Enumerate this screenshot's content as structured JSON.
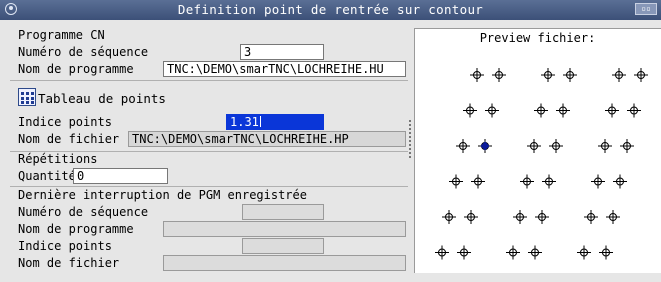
{
  "window": {
    "title": "Definition point de rentrée sur contour"
  },
  "section_programme": {
    "heading": "Programme CN",
    "seq_label": "Numéro de séquence",
    "seq_value": "3",
    "prog_label": "Nom de programme",
    "prog_value": "TNC:\\DEMO\\smarTNC\\LOCHREIHE.HU"
  },
  "section_points": {
    "table_label": "Tableau de points",
    "index_label": "Indice points",
    "index_value": "1.31",
    "file_label": "Nom de fichier",
    "file_value": "TNC:\\DEMO\\smarTNC\\LOCHREIHE.HP"
  },
  "section_repetitions": {
    "heading": "Répétitions",
    "qty_label": "Quantité",
    "qty_value": "0"
  },
  "section_interruption": {
    "heading": "Dernière interruption de PGM enregistrée",
    "seq_label": "Numéro de séquence",
    "prog_label": "Nom de programme",
    "index_label": "Indice points",
    "file_label": "Nom de fichier"
  },
  "preview": {
    "title": "Preview fichier:",
    "highlight_color": "#0a1a9a",
    "rows": [
      {
        "points": 6,
        "selected": -1
      },
      {
        "points": 6,
        "selected": -1
      },
      {
        "points": 6,
        "selected": 1
      },
      {
        "points": 6,
        "selected": -1
      },
      {
        "points": 6,
        "selected": -1
      },
      {
        "points": 6,
        "selected": -1
      }
    ]
  }
}
